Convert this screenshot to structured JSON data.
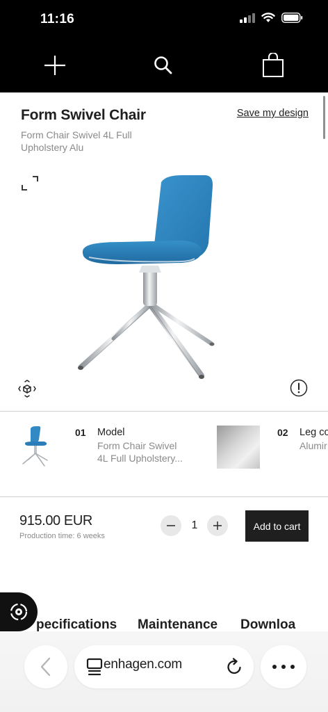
{
  "status_bar": {
    "time": "11:16"
  },
  "nav": {
    "menu_icon": "plus-menu-icon",
    "search_icon": "search-icon",
    "bag_icon": "shopping-bag-icon"
  },
  "product": {
    "title": "Form Swivel Chair",
    "save_label": "Save my design",
    "subtitle": "Form Chair Swivel 4L Full Upholstery Alu"
  },
  "configurator": [
    {
      "number": "01",
      "label": "Model",
      "value_line1": "Form Chair Swivel",
      "value_line2": "4L Full Upholstery..."
    },
    {
      "number": "02",
      "label": "Leg co",
      "value_line1": "Alumir"
    }
  ],
  "purchase": {
    "price": "915.00 EUR",
    "production_time": "Production time: 6 weeks",
    "quantity": "1",
    "add_to_cart": "Add to cart"
  },
  "tabs": [
    "pecifications",
    "Maintenance",
    "Downloa"
  ],
  "browser": {
    "url": "enhagen.com"
  },
  "colors": {
    "accent_blue": "#2f86c2",
    "dark": "#1f1f1f",
    "muted": "#8a8a8a"
  }
}
